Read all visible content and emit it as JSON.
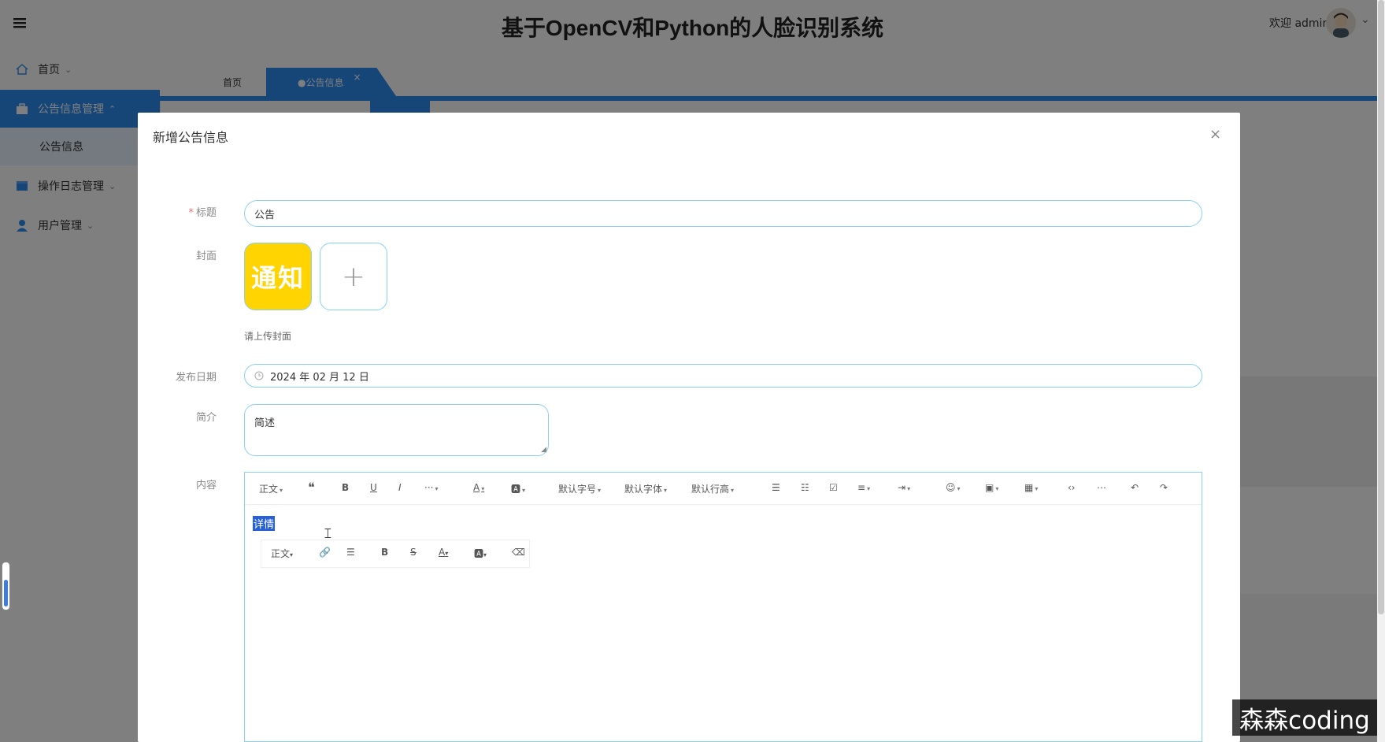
{
  "app": {
    "title": "基于OpenCV和Python的人脸识别系统",
    "welcome": "欢迎 admin"
  },
  "sidebar": {
    "items": [
      {
        "label": "首页",
        "icon": "home-icon"
      },
      {
        "label": "公告信息管理",
        "icon": "briefcase-icon"
      },
      {
        "label": "公告信息",
        "icon": ""
      },
      {
        "label": "操作日志管理",
        "icon": "log-icon"
      },
      {
        "label": "用户管理",
        "icon": "user-icon"
      }
    ]
  },
  "tabs": [
    {
      "label": "首页"
    },
    {
      "label": "●公告信息",
      "close": "×"
    }
  ],
  "modal": {
    "title": "新增公告信息",
    "close": "×",
    "fields": {
      "title_label": "标题",
      "title_required": "*",
      "title_value": "公告",
      "cover_label": "封面",
      "cover_image_text": "通知",
      "cover_add": "+",
      "cover_hint": "请上传封面",
      "date_label": "发布日期",
      "date_icon": "clock-icon",
      "date_value": "2024 年 02 月 12 日",
      "intro_label": "简介",
      "intro_value": "简述",
      "content_label": "内容"
    },
    "editor": {
      "toolbar": [
        "正文",
        "默认字号",
        "默认字体",
        "默认行高"
      ],
      "selected_text": "详情",
      "hover_toolbar": [
        "正文"
      ]
    }
  },
  "watermark": "森森coding",
  "colors": {
    "accent": "#2d8cf0",
    "input_border": "#8ad0f4",
    "cover_bg": "#ffd400"
  }
}
